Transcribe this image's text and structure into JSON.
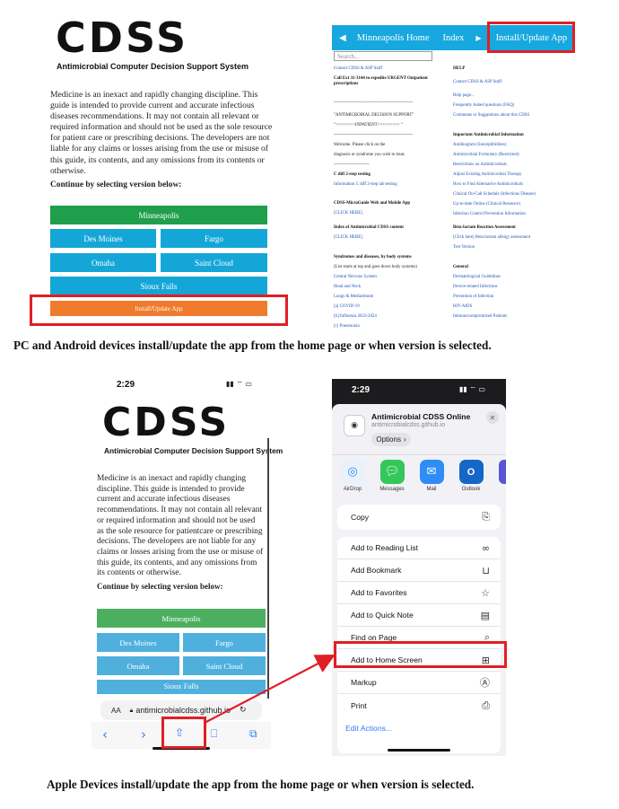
{
  "panel_pc": {
    "logo": "CDSS",
    "logo_subtitle": "Antimicrobial Computer Decision Support System",
    "intro": "Medicine is an inexact and rapidly changing discipline. This guide is intended to provide current and accurate infectious diseases recommendations. It may not contain all relevant or required information and should not be used as the sole resource for patient care or prescribing decisions. The developers are not liable for any claims or losses arising from the use or misuse of this guide, its contents, and any omissions from its contents or otherwise.",
    "continue": "Continue by selecting version below:",
    "versions": {
      "minneapolis": "Minneapolis",
      "des_moines": "Des Moines",
      "fargo": "Fargo",
      "omaha": "Omaha",
      "saint_cloud": "Saint Cloud",
      "sioux_falls": "Sioux Falls",
      "install": "Install/Update App"
    },
    "colors": {
      "green": "#1f9e4b",
      "blue": "#15a6d8",
      "orange": "#f07b2c",
      "highlight": "#e01f26"
    }
  },
  "panel_index": {
    "nav": {
      "back_icon": "triangle-left-icon",
      "home": "Minneapolis Home",
      "index": "Index",
      "forward_icon": "triangle-right-icon",
      "install": "Install/Update App"
    },
    "search_placeholder": "Search...",
    "left": [
      "Contact CDSS & ASP Staff",
      "Call Ext 31-3144 to expedite URGENT Outpatient",
      "prescriptions",
      "------------------------------------------------------",
      "\"ANTIMICROBIAL DECISION SUPPORT\"",
      "\">>>>>>>>INPATIENT<<<<<<<<< \"",
      "------------------------------------------------------",
      "Welcome. Please click on the",
      "diagnosis or syndrome you wish to treat.",
      "~~~~~~~~~~~~~~~",
      "C diff 2-step testing",
      "Information C diff 2-step lab testing",
      "CDSS-MicroGuide Web and Mobile App",
      "[CLICK HERE]",
      "Index of Antimicrobial CDSS content",
      "[CLICK HERE]",
      "Syndromes and diseases, by body systems",
      "(List starts at top and goes down body systems)",
      "Central Nervous System",
      "Head and Neck",
      "Lungs & Mediastinum",
      "[a] COVID-19",
      "[b] Influenza 2023-2024",
      "[c] Pneumonia"
    ],
    "right": [
      "HELP",
      "Contact CDSS & ASP Staff",
      "Help page...",
      "Frequently Asked questions (FAQ)",
      "Comments or Suggestions about this CDSS",
      "Important Antimicrobial Information",
      "Antibiogram (Susceptibilities)",
      "Antimicrobial Formulary (Restricted)",
      "Restrictions on Antimicrobials",
      "Adjust Existing Antimicrobial Therapy",
      "How to Find Alternative Antimicrobials",
      "Clinical On-Call Schedule (Infectious Disease)",
      "Up-to-date Online (Clinical Resource)",
      "Infection Control Prevention Information",
      "Beta-lactam Reaction Assessment",
      "[Click here] Beta-lactam allergy assessment",
      "Test Version",
      "General",
      "Dermatological Guidelines",
      "Device-related Infections",
      "Prevention of Infection",
      "HIV-AIDS",
      "Immunocompromized Patients"
    ]
  },
  "caption_top": "PC and Android devices install/update the app from the home page or when version is selected.",
  "phone_home": {
    "time": "2:29",
    "status_icons": "signal-wifi-battery-icons",
    "logo": "CDSS",
    "logo_subtitle": "Antimicrobial Computer Decision Support System",
    "intro": "Medicine is an inexact and rapidly changing discipline. This guide is intended to provide current and accurate infectious diseases recommendations. It may not contain all relevant or required information and should not be used as the sole resource for patientcare or prescribing decisions. The developers are not liable for any claims or losses arising from the use or misuse of this guide, its contents, and any omissions from its contents or otherwise.",
    "continue": "Continue by selecting version below:",
    "versions": {
      "minneapolis": "Minneapolis",
      "des_moines": "Des Moines",
      "fargo": "Fargo",
      "omaha": "Omaha",
      "saint_cloud": "Saint Cloud",
      "sioux_falls": "Sioux Falls"
    },
    "address_aa": "AA",
    "address_url": "antimicrobialcdss.github.io",
    "toolbar_icons": [
      "back-icon",
      "forward-icon",
      "share-icon",
      "bookmarks-icon",
      "tabs-icon"
    ]
  },
  "phone_share": {
    "time": "2:29",
    "app_title": "Antimicrobial CDSS Online",
    "app_url": "antimicrobialcdss.github.io",
    "options": "Options",
    "close_icon": "close-icon",
    "apps": [
      {
        "label": "AirDrop",
        "icon": "airdrop-icon",
        "color": "#e9f2fb"
      },
      {
        "label": "Messages",
        "icon": "messages-icon",
        "color": "#34c759"
      },
      {
        "label": "Mail",
        "icon": "mail-icon",
        "color": "#2f8cf6"
      },
      {
        "label": "Outlook",
        "icon": "outlook-icon",
        "color": "#1467c6"
      }
    ],
    "actions_top": [
      {
        "label": "Copy",
        "icon": "copy-icon"
      }
    ],
    "actions_main": [
      {
        "label": "Add to Reading List",
        "icon": "glasses-icon"
      },
      {
        "label": "Add Bookmark",
        "icon": "book-icon"
      },
      {
        "label": "Add to Favorites",
        "icon": "star-icon"
      },
      {
        "label": "Add to Quick Note",
        "icon": "quick-note-icon"
      },
      {
        "label": "Find on Page",
        "icon": "find-icon"
      },
      {
        "label": "Add to Home Screen",
        "icon": "plus-square-icon"
      },
      {
        "label": "Markup",
        "icon": "markup-icon"
      },
      {
        "label": "Print",
        "icon": "printer-icon"
      }
    ],
    "edit_actions": "Edit Actions..."
  },
  "caption_bottom": "Apple Devices install/update the app from the home page or when version is selected.",
  "annotation_color": "#e01f26"
}
